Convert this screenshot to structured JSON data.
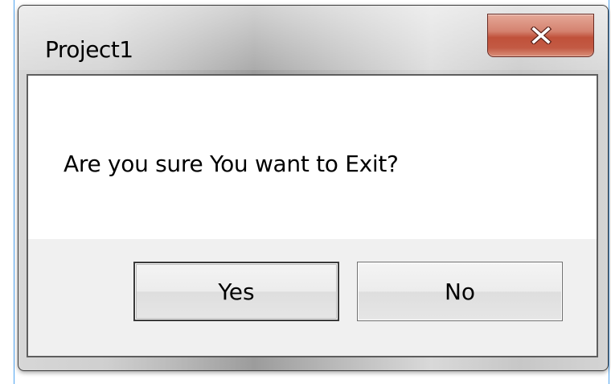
{
  "window": {
    "title": "Project1",
    "close_icon": "close-icon"
  },
  "dialog": {
    "message": "Are you sure You want to Exit?",
    "buttons": {
      "yes_label": "Yes",
      "no_label": "No"
    }
  },
  "colors": {
    "close_button": "#c75a43",
    "desktop_edge": "#4ea3f0",
    "client_background": "#f0f0f0",
    "message_background": "#ffffff"
  }
}
